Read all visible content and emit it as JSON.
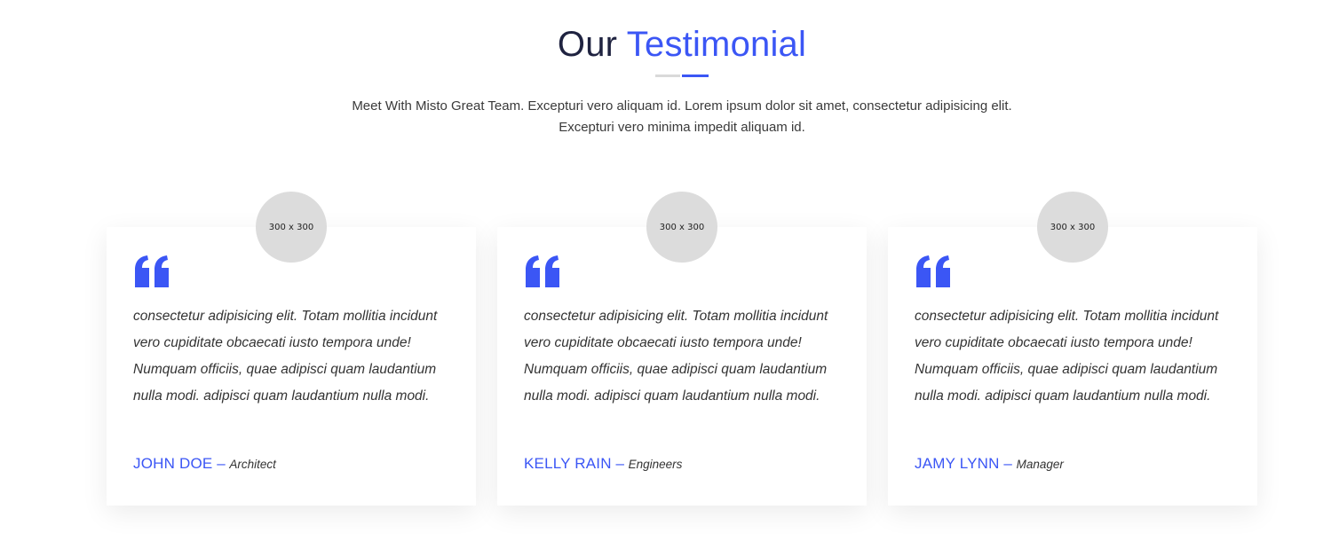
{
  "header": {
    "title_part1": "Our",
    "title_part2": "Testimonial",
    "subtitle_line1": "Meet With Misto Great Team. Excepturi vero aliquam id. Lorem ipsum dolor sit amet, consectetur adipisicing elit.",
    "subtitle_line2": "Excepturi vero minima impedit aliquam id."
  },
  "colors": {
    "accent": "#3b56f5",
    "heading_dark": "#1f2340",
    "avatar_placeholder": "#dcdcdc"
  },
  "testimonials": [
    {
      "avatar_label": "300 x 300",
      "quote_icon": "quote-icon",
      "text": "consectetur adipisicing elit. Totam mollitia incidunt vero cupiditate obcaecati iusto tempora unde! Numquam officiis, quae adipisci quam laudantium nulla modi. adipisci quam laudantium nulla modi.",
      "name": "JOHN DOE",
      "separator": "–",
      "role": "Architect"
    },
    {
      "avatar_label": "300 x 300",
      "quote_icon": "quote-icon",
      "text": "consectetur adipisicing elit. Totam mollitia incidunt vero cupiditate obcaecati iusto tempora unde! Numquam officiis, quae adipisci quam laudantium nulla modi. adipisci quam laudantium nulla modi.",
      "name": "KELLY RAIN",
      "separator": "–",
      "role": "Engineers"
    },
    {
      "avatar_label": "300 x 300",
      "quote_icon": "quote-icon",
      "text": "consectetur adipisicing elit. Totam mollitia incidunt vero cupiditate obcaecati iusto tempora unde! Numquam officiis, quae adipisci quam laudantium nulla modi. adipisci quam laudantium nulla modi.",
      "name": "JAMY LYNN",
      "separator": "–",
      "role": "Manager"
    }
  ]
}
